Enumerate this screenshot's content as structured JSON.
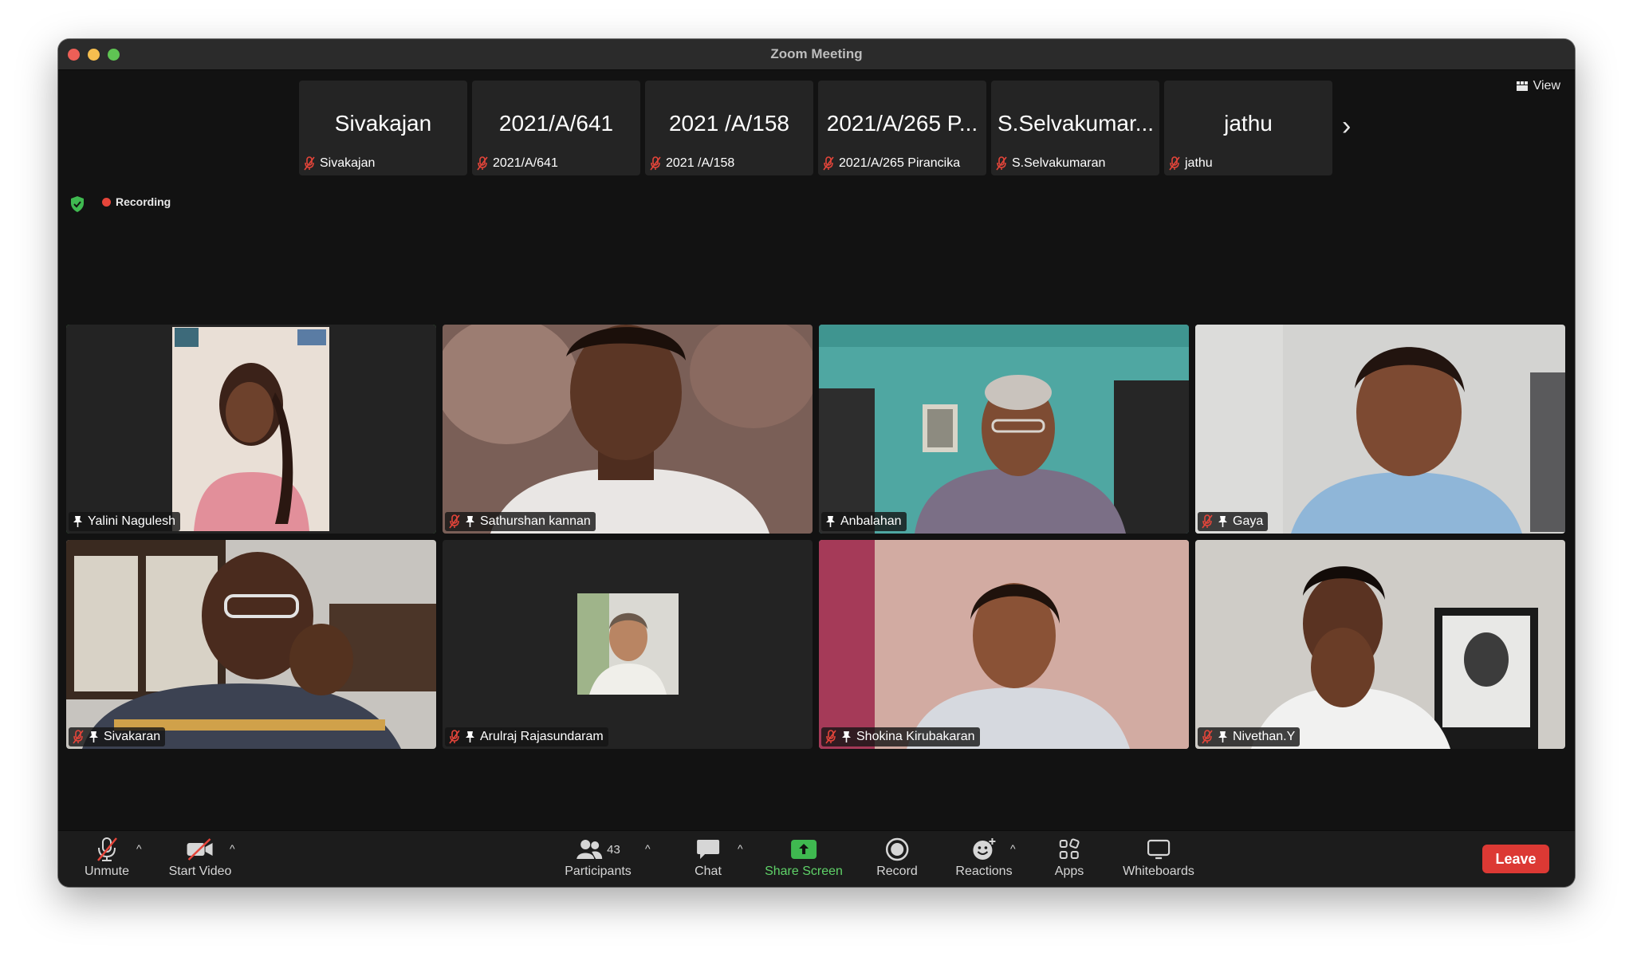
{
  "window": {
    "title": "Zoom Meeting"
  },
  "view": {
    "label": "View"
  },
  "recording": {
    "label": "Recording"
  },
  "strip": {
    "tiles": [
      {
        "display": "Sivakajan",
        "name": "Sivakajan"
      },
      {
        "display": "2021/A/641",
        "name": "2021/A/641"
      },
      {
        "display": "2021 /A/158",
        "name": "2021 /A/158"
      },
      {
        "display": "2021/A/265 P...",
        "name": "2021/A/265 Pirancika"
      },
      {
        "display": "S.Selvakumar...",
        "name": "S.Selvakumaran"
      },
      {
        "display": "jathu",
        "name": "jathu"
      }
    ]
  },
  "grid": {
    "tiles": [
      {
        "name": "Yalini Nagulesh"
      },
      {
        "name": "Sathurshan kannan"
      },
      {
        "name": "Anbalahan"
      },
      {
        "name": "Gaya"
      },
      {
        "name": "Sivakaran"
      },
      {
        "name": "Arulraj Rajasundaram"
      },
      {
        "name": "Shokina Kirubakaran"
      },
      {
        "name": "Nivethan.Y"
      }
    ]
  },
  "toolbar": {
    "unmute": "Unmute",
    "start_video": "Start Video",
    "participants": "Participants",
    "participant_count": "43",
    "chat": "Chat",
    "share_screen": "Share Screen",
    "record": "Record",
    "reactions": "Reactions",
    "apps": "Apps",
    "whiteboards": "Whiteboards",
    "leave": "Leave"
  },
  "colors": {
    "active_speaker": "#5fcf63",
    "share_screen": "#5fd268",
    "leave": "#dc3934",
    "muted": "#e5453a"
  }
}
